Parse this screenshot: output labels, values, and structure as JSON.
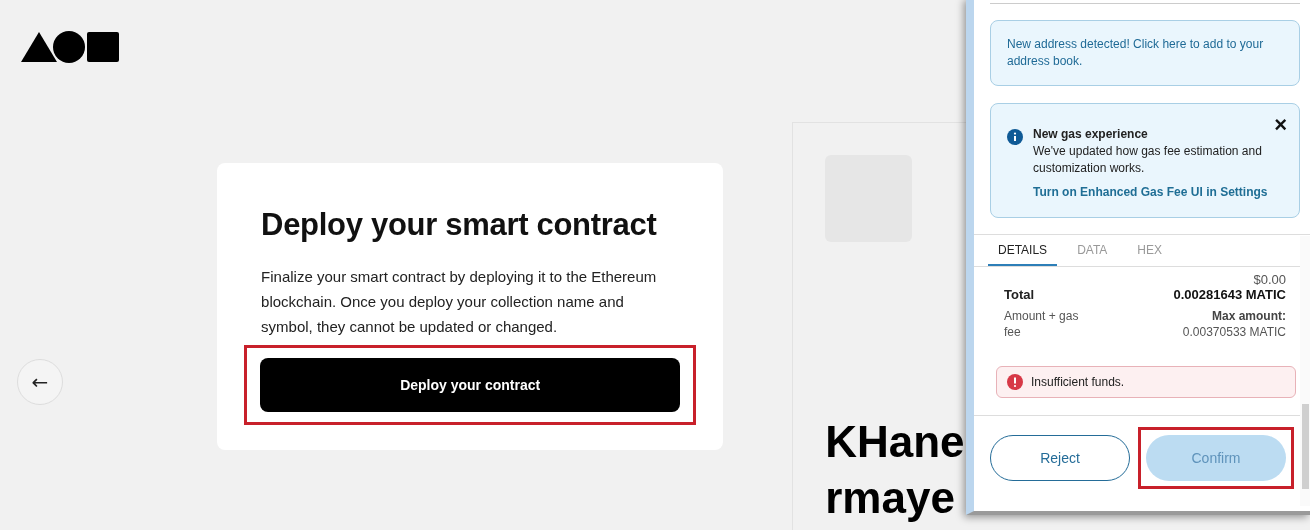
{
  "page": {
    "back_button": {
      "label": "←"
    },
    "card": {
      "title": "Deploy your smart contract",
      "text": "Finalize your smart contract by deploying it to the Ethereum blockchain. Once you deploy your collection name and symbol, they cannot be updated or changed.",
      "button": {
        "label": "Deploy your contract",
        "highlighted": true
      }
    },
    "side_panel": {
      "heading_lines": [
        "KHane",
        "rmaye"
      ]
    }
  },
  "popup": {
    "address_notice": "New address detected! Click here to add to your address book.",
    "gas_notice": {
      "title": "New gas experience",
      "text": "We've updated how gas fee estimation and customization works.",
      "link": "Turn on Enhanced Gas Fee UI in Settings",
      "close": "×"
    },
    "tabs": [
      {
        "label": "DETAILS",
        "selected": true
      },
      {
        "label": "DATA",
        "selected": false
      },
      {
        "label": "HEX",
        "selected": false
      }
    ],
    "total": {
      "fiat": "$0.00",
      "label": "Total",
      "amount": "0.00281643 MATIC",
      "sublabel": "Amount + gas fee",
      "max_label": "Max amount:",
      "max_amount": "0.00370533 MATIC"
    },
    "error": "Insufficient funds.",
    "buttons": [
      {
        "label": "Reject",
        "kind": "secondary",
        "disabled": false,
        "highlighted": false
      },
      {
        "label": "Confirm",
        "kind": "primary",
        "disabled": true,
        "highlighted": true
      }
    ]
  }
}
